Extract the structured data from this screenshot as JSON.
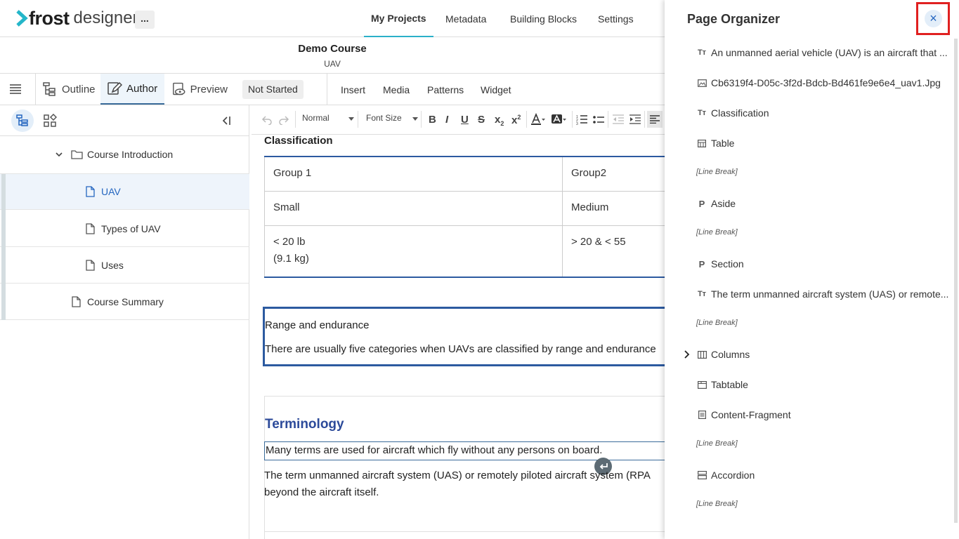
{
  "app": {
    "logo_bold": "frost",
    "logo_light": "designer",
    "more_label": "..."
  },
  "top_nav": [
    "My Projects",
    "Metadata",
    "Building Blocks",
    "Settings"
  ],
  "course": {
    "title": "Demo Course",
    "subtitle": "UAV"
  },
  "modes": {
    "outline": "Outline",
    "author": "Author",
    "preview": "Preview",
    "status": "Not Started"
  },
  "insert_menu": [
    "Insert",
    "Media",
    "Patterns",
    "Widget"
  ],
  "toolbar": {
    "format": "Normal",
    "font_size": "Font Size"
  },
  "tree": [
    {
      "label": "Course Introduction",
      "type": "folder"
    },
    {
      "label": "UAV",
      "type": "page",
      "selected": true
    },
    {
      "label": "Types of UAV",
      "type": "page"
    },
    {
      "label": "Uses",
      "type": "page"
    },
    {
      "label": "Course Summary",
      "type": "page"
    }
  ],
  "content": {
    "heading": "Classification",
    "table": [
      [
        "Group 1",
        "Group2"
      ],
      [
        "Small",
        "Medium"
      ],
      [
        "< 20 lb",
        "> 20 & < 55"
      ]
    ],
    "table_extra": "(9.1 kg)",
    "aside_title": "Range and endurance",
    "aside_text": "There are usually five categories when UAVs are classified by range and endurance",
    "section_title": "Terminology",
    "section_line": "Many terms are used for aircraft which fly without any persons on board.",
    "para1": "The term unmanned aircraft system (UAS) or remotely piloted aircraft system (RPA",
    "para2": "beyond the aircraft itself."
  },
  "organizer": {
    "title": "Page Organizer",
    "close": "×",
    "items": [
      {
        "icon": "text-icon",
        "label": "An unmanned aerial vehicle (UAV) is an aircraft that ..."
      },
      {
        "icon": "image-icon",
        "label": "Cb6319f4-D05c-3f2d-Bdcb-Bd461fe9e6e4_uav1.Jpg"
      },
      {
        "icon": "text-icon",
        "label": "Classification"
      },
      {
        "icon": "table-icon",
        "label": "Table"
      },
      {
        "icon": "none",
        "label": "[Line Break]"
      },
      {
        "icon": "paragraph-icon",
        "label": "Aside"
      },
      {
        "icon": "none",
        "label": "[Line Break]"
      },
      {
        "icon": "paragraph-icon",
        "label": "Section"
      },
      {
        "icon": "text-icon",
        "label": "The term unmanned aircraft system (UAS) or remote..."
      },
      {
        "icon": "none",
        "label": "[Line Break]"
      },
      {
        "icon": "columns-icon",
        "label": "Columns"
      },
      {
        "icon": "tabtable-icon",
        "label": "Tabtable"
      },
      {
        "icon": "fragment-icon",
        "label": "Content-Fragment"
      },
      {
        "icon": "none",
        "label": "[Line Break]"
      },
      {
        "icon": "accordion-icon",
        "label": "Accordion"
      },
      {
        "icon": "none",
        "label": "[Line Break]"
      }
    ]
  }
}
